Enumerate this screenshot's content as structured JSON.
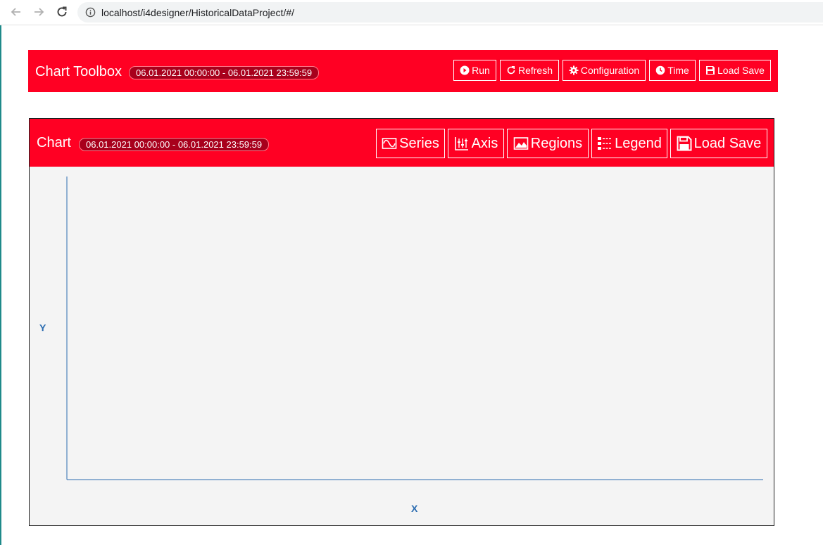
{
  "browser": {
    "url": "localhost/i4designer/HistoricalDataProject/#/"
  },
  "toolbox": {
    "title": "Chart Toolbox",
    "date_range": "06.01.2021 00:00:00 - 06.01.2021 23:59:59",
    "buttons": {
      "run": "Run",
      "refresh": "Refresh",
      "configuration": "Configuration",
      "time": "Time",
      "load_save": "Load Save"
    }
  },
  "chart": {
    "title": "Chart",
    "date_range": "06.01.2021 00:00:00 - 06.01.2021 23:59:59",
    "buttons": {
      "series": "Series",
      "axis": "Axis",
      "regions": "Regions",
      "legend": "Legend",
      "load_save": "Load Save"
    },
    "y_label": "Y",
    "x_label": "X"
  },
  "colors": {
    "brand_red": "#ff0023",
    "axis_blue": "#2b6cb0"
  }
}
